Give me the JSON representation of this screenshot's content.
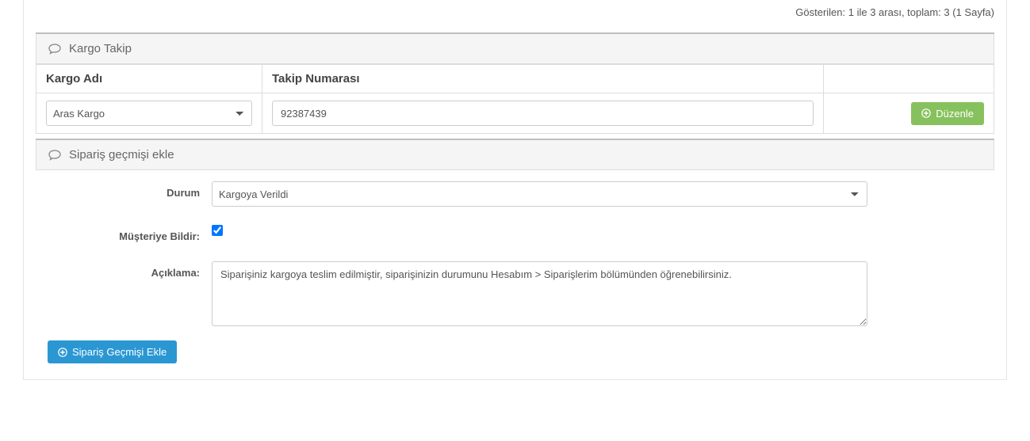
{
  "top_info": "Gösterilen: 1 ile 3 arası, toplam: 3 (1 Sayfa)",
  "cargo_panel": {
    "title": "Kargo Takip",
    "col_carrier": "Kargo Adı",
    "col_tracking": "Takip Numarası",
    "carrier_selected": "Aras Kargo",
    "tracking_value": "92387439",
    "edit_button": "Düzenle"
  },
  "history_panel": {
    "title": "Sipariş geçmişi ekle",
    "status_label": "Durum",
    "status_selected": "Kargoya Verildi",
    "notify_label": "Müşteriye Bildir:",
    "notify_checked": true,
    "desc_label": "Açıklama:",
    "desc_value": "Siparişiniz kargoya teslim edilmiştir, siparişinizin durumunu Hesabım > Siparişlerim bölümünden öğrenebilirsiniz.",
    "submit_button": "Sipariş Geçmişi Ekle"
  }
}
